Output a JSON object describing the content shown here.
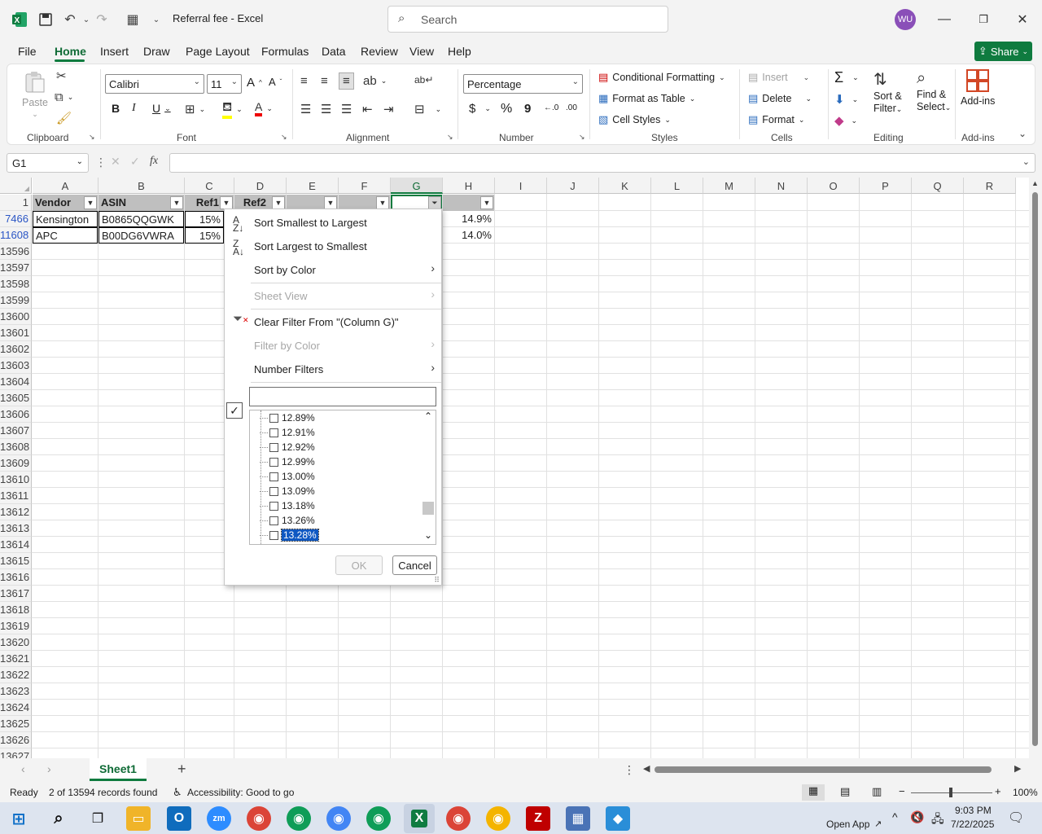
{
  "titlebar": {
    "doc_title": "Referral fee  -  Excel",
    "search_placeholder": "Search",
    "avatar": "WU"
  },
  "menu": [
    "File",
    "Home",
    "Insert",
    "Draw",
    "Page Layout",
    "Formulas",
    "Data",
    "Review",
    "View",
    "Help"
  ],
  "share_label": "Share",
  "ribbon": {
    "clipboard": {
      "paste": "Paste",
      "label": "Clipboard"
    },
    "font": {
      "name": "Calibri",
      "size": "11",
      "label": "Font"
    },
    "alignment": {
      "label": "Alignment"
    },
    "number": {
      "format": "Percentage",
      "label": "Number",
      "currency": "$",
      "percent": "%",
      "comma": "9"
    },
    "styles": {
      "conditional": "Conditional Formatting",
      "table": "Format as Table",
      "cell_styles": "Cell Styles",
      "label": "Styles"
    },
    "cells": {
      "insert": "Insert",
      "delete": "Delete",
      "format": "Format",
      "label": "Cells"
    },
    "editing": {
      "sort": "Sort &",
      "filter": "Filter",
      "find": "Find &",
      "select": "Select",
      "label": "Editing"
    },
    "addins": {
      "btn": "Add-ins",
      "label": "Add-ins"
    }
  },
  "formula_bar": {
    "name_box": "G1",
    "fx": "fx",
    "content": ""
  },
  "columns": [
    "A",
    "B",
    "C",
    "D",
    "E",
    "F",
    "G",
    "H",
    "I",
    "J",
    "K",
    "L",
    "M",
    "N",
    "O",
    "P",
    "Q",
    "R"
  ],
  "rows": [
    "1",
    "7466",
    "11608",
    "13596",
    "13597",
    "13598",
    "13599",
    "13600",
    "13601",
    "13602",
    "13603",
    "13604",
    "13605",
    "13606",
    "13607",
    "13608",
    "13609",
    "13610",
    "13611",
    "13612",
    "13613",
    "13614",
    "13615",
    "13616",
    "13617",
    "13618",
    "13619",
    "13620",
    "13621",
    "13622",
    "13623",
    "13624",
    "13625",
    "13626",
    "13627"
  ],
  "table": {
    "headers": [
      "Vendor",
      "ASIN",
      "Ref1",
      "Ref2"
    ],
    "rows": [
      {
        "vendor": "Kensington",
        "asin": "B0865QQGWK",
        "ref1": "15%",
        "h": "14.9%"
      },
      {
        "vendor": "APC",
        "asin": "B00DG6VWRA",
        "ref1": "15%",
        "h": "14.0%"
      }
    ]
  },
  "filter_menu": {
    "sort_asc": "Sort Smallest to Largest",
    "sort_desc": "Sort Largest to Smallest",
    "sort_color": "Sort by Color",
    "sheet_view": "Sheet View",
    "clear_filter": "Clear Filter From \"(Column G)\"",
    "filter_color": "Filter by Color",
    "number_filters": "Number Filters",
    "search_value": "",
    "values": [
      "12.89%",
      "12.91%",
      "12.92%",
      "12.99%",
      "13.00%",
      "13.09%",
      "13.18%",
      "13.26%",
      "13.28%"
    ],
    "ok": "OK",
    "cancel": "Cancel"
  },
  "sheet_tab": "Sheet1",
  "status": {
    "ready": "Ready",
    "records": "2 of 13594 records found",
    "accessibility": "Accessibility: Good to go",
    "zoom": "100%"
  },
  "taskbar": {
    "open_app": "Open App",
    "time": "9:03 PM",
    "date": "7/22/2025"
  }
}
